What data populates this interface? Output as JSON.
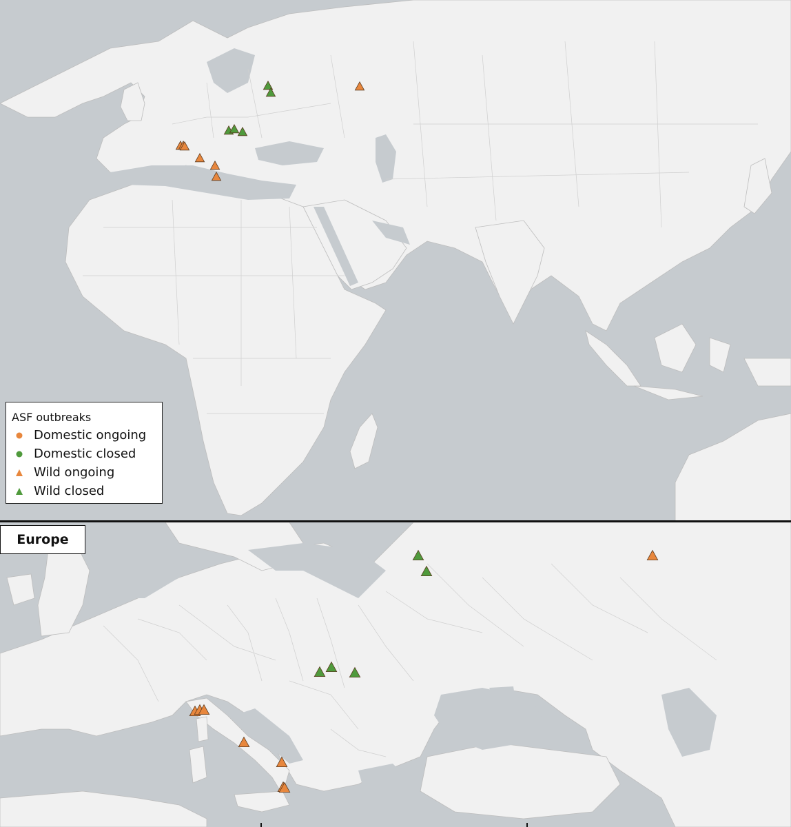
{
  "legend": {
    "title": "ASF outbreaks",
    "items": [
      {
        "label": "Domestic ongoing",
        "symbol": "circle",
        "color": "#e8873d"
      },
      {
        "label": "Domestic closed",
        "symbol": "circle",
        "color": "#4f9a3c"
      },
      {
        "label": "Wild ongoing",
        "symbol": "triangle",
        "color": "#e8873d"
      },
      {
        "label": "Wild closed",
        "symbol": "triangle",
        "color": "#4f9a3c"
      }
    ]
  },
  "inset": {
    "label": "Europe"
  },
  "colors": {
    "ongoing": "#e8873d",
    "closed": "#4f9a3c",
    "water": "#c6cbcf",
    "land": "#f1f1f1"
  }
}
